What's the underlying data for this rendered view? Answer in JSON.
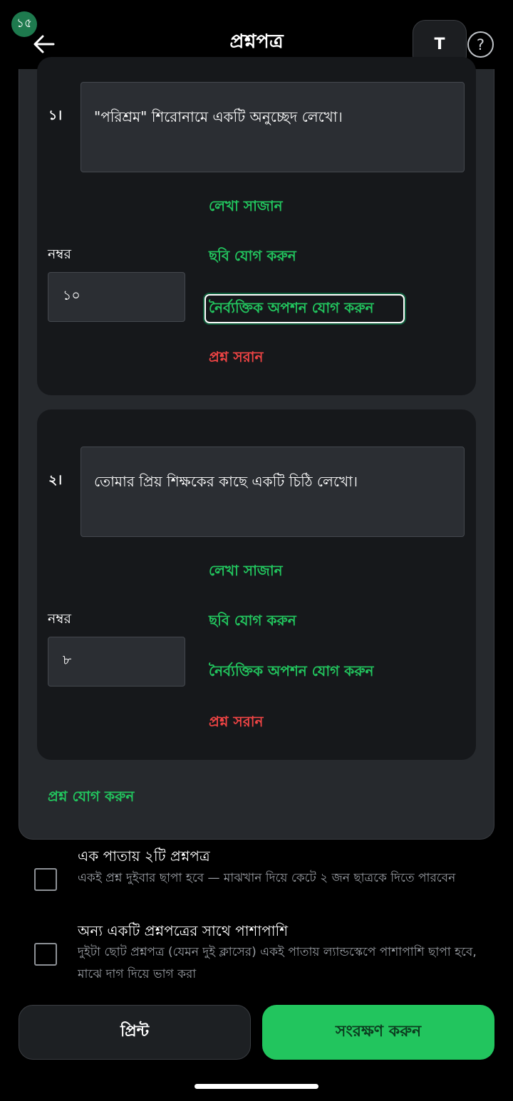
{
  "status": {
    "badge": "১৫"
  },
  "header": {
    "title": "প্রশ্নপত্র",
    "font_button": "T",
    "help_button": "?"
  },
  "questions": [
    {
      "number": "১।",
      "text": "\"পরিশ্রম\" শিরোনামে একটি অনুচ্ছেদ লেখো।",
      "format_label": "লেখা সাজান",
      "marks_label": "নম্বর",
      "marks_value": "১০",
      "add_image_label": "ছবি যোগ করুন",
      "add_mcq_label": "নৈর্ব্যক্তিক অপশন যোগ করুন",
      "remove_label": "প্রশ্ন সরান"
    },
    {
      "number": "২।",
      "text": "তোমার প্রিয় শিক্ষকের কাছে একটি চিঠি লেখো।",
      "format_label": "লেখা সাজান",
      "marks_label": "নম্বর",
      "marks_value": "৮",
      "add_image_label": "ছবি যোগ করুন",
      "add_mcq_label": "নৈর্ব্যক্তিক অপশন যোগ করুন",
      "remove_label": "প্রশ্ন সরান"
    }
  ],
  "add_question_label": "প্রশ্ন যোগ করুন",
  "options": [
    {
      "title": "এক পাতায় ২টি প্রশ্নপত্র",
      "description": "একই প্রশ্ন দুইবার ছাপা হবে — মাঝখান দিয়ে কেটে ২ জন ছাত্রকে দিতে পারবেন",
      "checked": false
    },
    {
      "title": "অন্য একটি প্রশ্নপত্রের সাথে পাশাপাশি",
      "description": "দুইটা ছোট প্রশ্নপত্র (যেমন দুই ক্লাসের) একই পাতায় ল্যান্ডস্কেপে পাশাপাশি ছাপা হবে, মাঝে দাগ দিয়ে ভাগ করা",
      "checked": false
    }
  ],
  "footer": {
    "print_label": "প্রিন্ট",
    "save_label": "সংরক্ষণ করুন"
  },
  "colors": {
    "accent": "#22c55e",
    "danger": "#ef4444",
    "card": "#16181b",
    "panel": "#26292d"
  }
}
